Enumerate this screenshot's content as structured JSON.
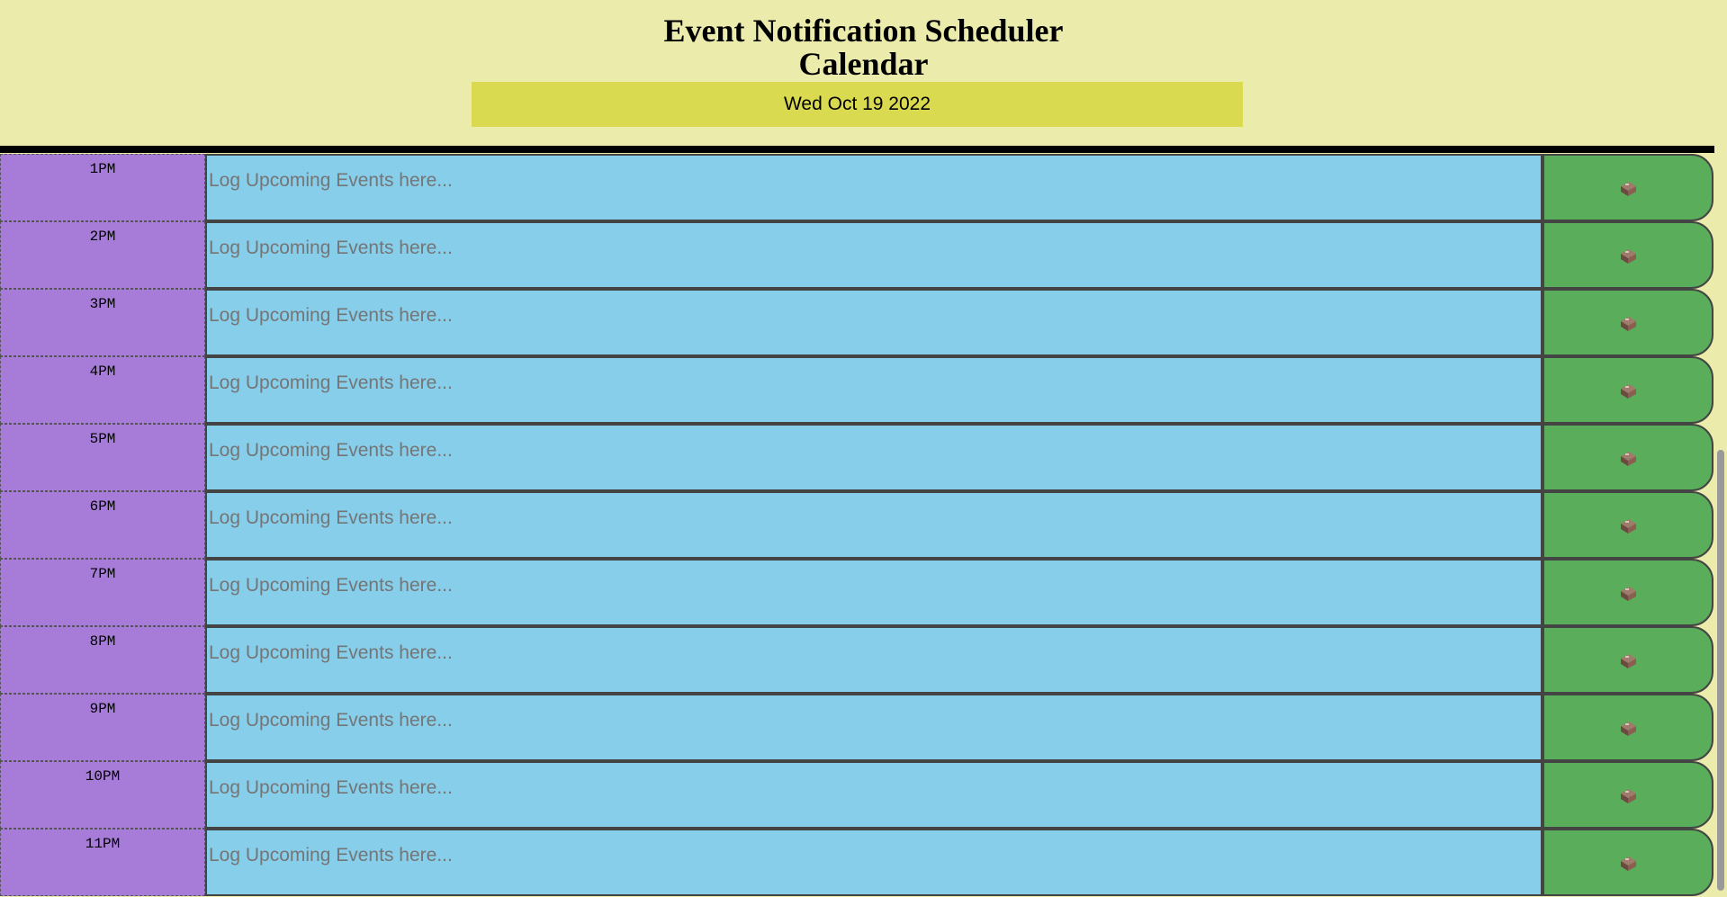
{
  "header": {
    "title_line1": "Event Notification Scheduler",
    "title_line2": "Calendar",
    "current_date": "Wed Oct 19 2022"
  },
  "textarea_placeholder": "Log Upcoming Events here...",
  "save_icon": "floppy-save-icon",
  "colors": {
    "background": "#ebebab",
    "date_bar": "#dada50",
    "hour_cell": "#a67cd8",
    "description": "#87ceeb",
    "save_button": "#5aad5a"
  },
  "rows": [
    {
      "hour": "1PM"
    },
    {
      "hour": "2PM"
    },
    {
      "hour": "3PM"
    },
    {
      "hour": "4PM"
    },
    {
      "hour": "5PM"
    },
    {
      "hour": "6PM"
    },
    {
      "hour": "7PM"
    },
    {
      "hour": "8PM"
    },
    {
      "hour": "9PM"
    },
    {
      "hour": "10PM"
    },
    {
      "hour": "11PM"
    }
  ]
}
